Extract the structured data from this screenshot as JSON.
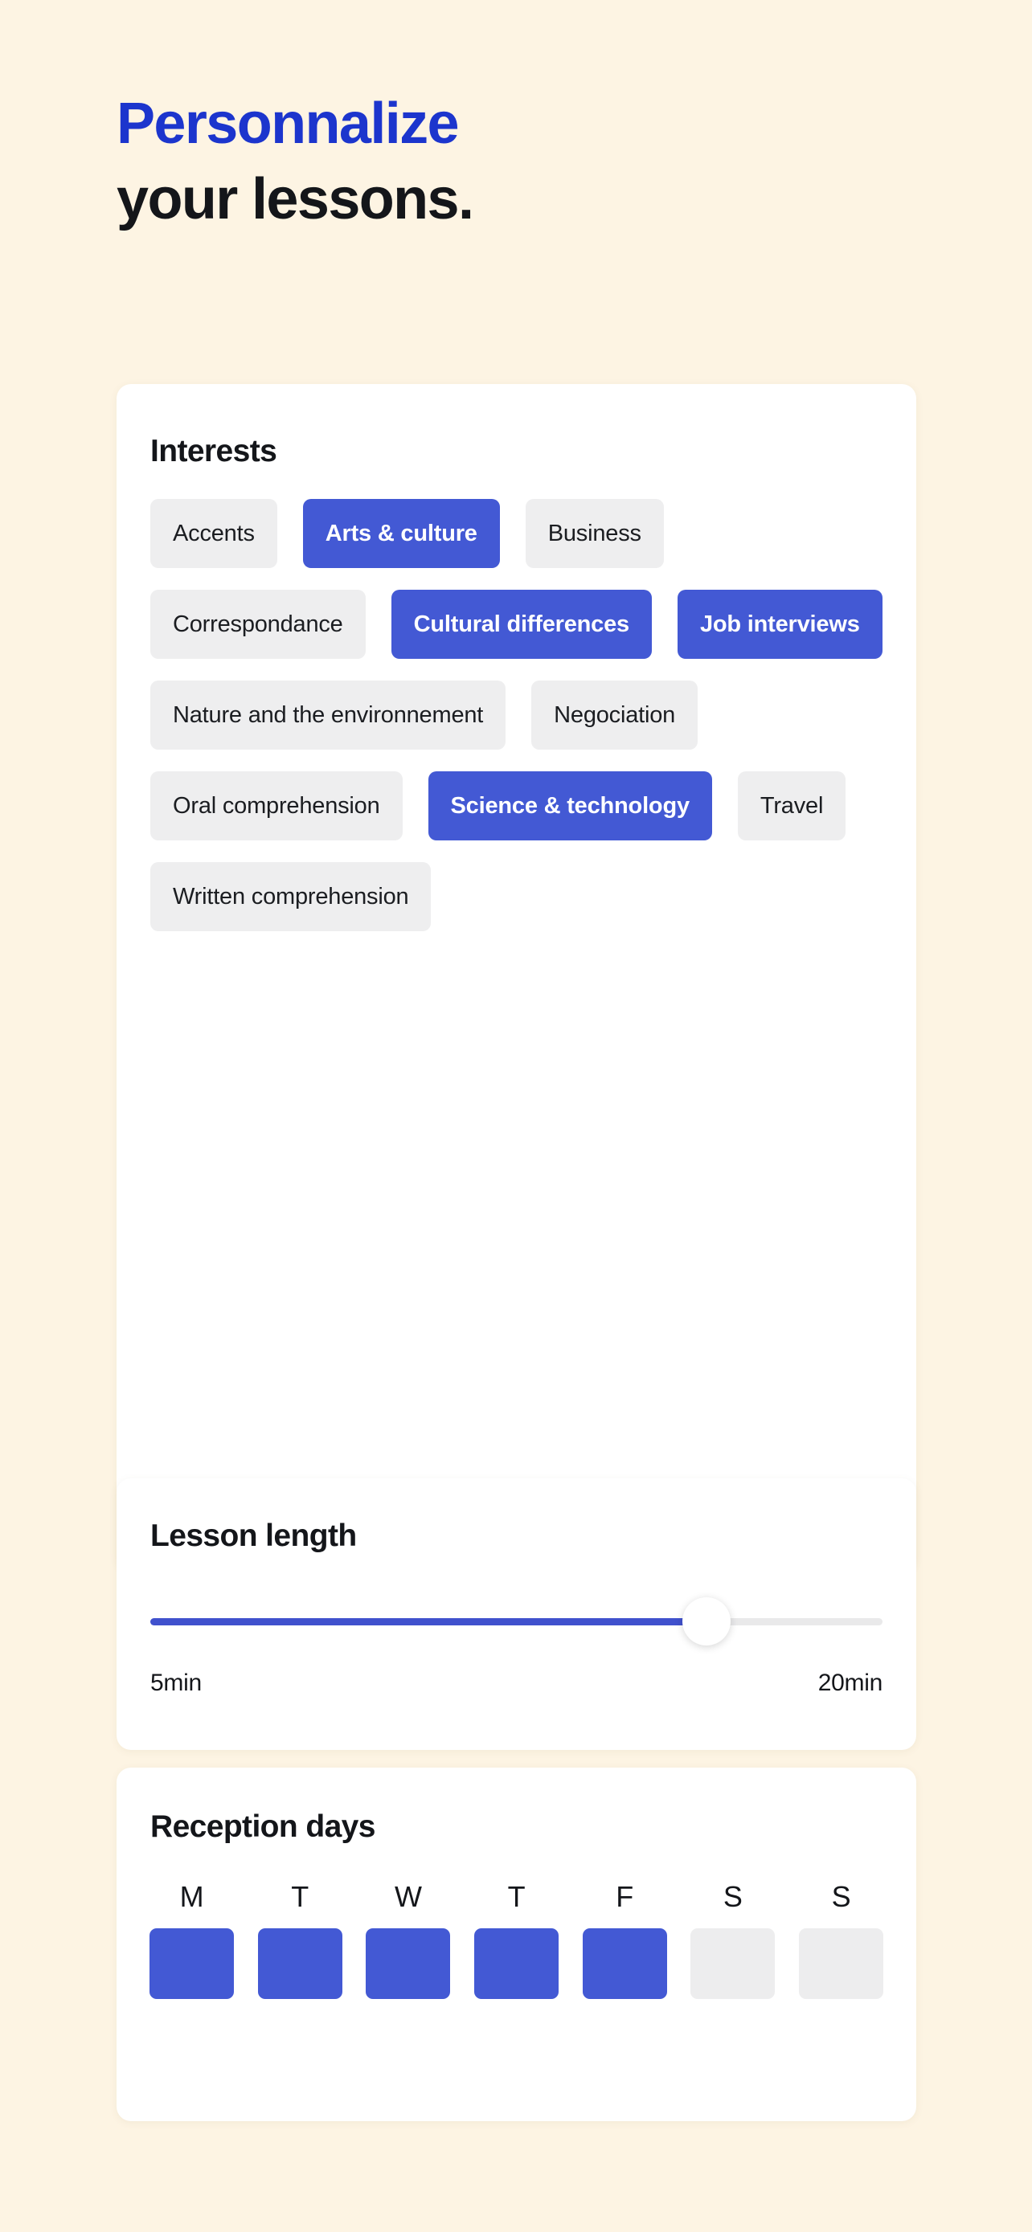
{
  "heading": {
    "line1": "Personnalize",
    "line2": "your lessons."
  },
  "colors": {
    "background": "#fdf4e3",
    "heading_accent": "#1c35cd",
    "chip_selected": "#4359d4",
    "chip_unselected": "#eeeeef",
    "slider_fill": "#4051cd",
    "card": "#ffffff"
  },
  "interests": {
    "title": "Interests",
    "chips": [
      {
        "label": "Accents",
        "selected": false
      },
      {
        "label": "Arts & culture",
        "selected": true
      },
      {
        "label": "Business",
        "selected": false
      },
      {
        "label": "Correspondance",
        "selected": false
      },
      {
        "label": "Cultural differences",
        "selected": true
      },
      {
        "label": "Job interviews",
        "selected": true
      },
      {
        "label": "Nature and the environnement",
        "selected": false
      },
      {
        "label": "Negociation",
        "selected": false
      },
      {
        "label": "Oral comprehension",
        "selected": false
      },
      {
        "label": "Science & technology",
        "selected": true
      },
      {
        "label": "Travel",
        "selected": false
      },
      {
        "label": "Written comprehension",
        "selected": false
      }
    ]
  },
  "lesson_length": {
    "title": "Lesson length",
    "min_label": "5min",
    "max_label": "20min",
    "min_value": 5,
    "max_value": 20,
    "percent": 76
  },
  "reception_days": {
    "title": "Reception days",
    "days": [
      {
        "label": "M",
        "selected": true
      },
      {
        "label": "T",
        "selected": true
      },
      {
        "label": "W",
        "selected": true
      },
      {
        "label": "T",
        "selected": true
      },
      {
        "label": "F",
        "selected": true
      },
      {
        "label": "S",
        "selected": false
      },
      {
        "label": "S",
        "selected": false
      }
    ]
  }
}
